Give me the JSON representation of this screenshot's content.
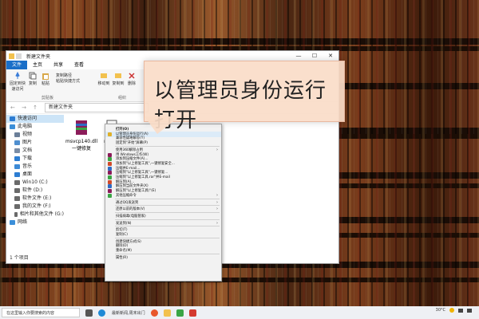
{
  "window": {
    "title": "新建文件夹",
    "tabs": [
      "文件",
      "主页",
      "共享",
      "查看"
    ],
    "ribbon": {
      "pin_label": "固定到快速访问",
      "copy_label": "复制",
      "paste_label": "粘贴",
      "copy_path_label": "复制路径",
      "paste_shortcut_label": "粘贴快捷方式",
      "clipboard_group": "剪贴板",
      "move_label": "移动到",
      "copy_to_label": "复制到",
      "delete_label": "删除",
      "organize_group": "组织"
    },
    "address_path": "新建文件夹",
    "nav_items": [
      {
        "label": "快速访问",
        "icon": "star-icon",
        "color": "#2d7dd2"
      },
      {
        "label": "此电脑",
        "icon": "computer-icon",
        "color": "#3b8fd9"
      },
      {
        "label": "视频",
        "icon": "video-icon",
        "color": "#6b7f99"
      },
      {
        "label": "图片",
        "icon": "picture-icon",
        "color": "#4f8fcf"
      },
      {
        "label": "文档",
        "icon": "document-icon",
        "color": "#7b8da6"
      },
      {
        "label": "下载",
        "icon": "download-icon",
        "color": "#2d7dd2"
      },
      {
        "label": "音乐",
        "icon": "music-icon",
        "color": "#3d8ad6"
      },
      {
        "label": "桌面",
        "icon": "desktop-icon",
        "color": "#2d7dd2"
      },
      {
        "label": "Win10 (C:)",
        "icon": "drive-icon",
        "color": "#6a6a6a"
      },
      {
        "label": "软件 (D:)",
        "icon": "drive-icon",
        "color": "#6a6a6a"
      },
      {
        "label": "软件文件 (E:)",
        "icon": "drive-icon",
        "color": "#6a6a6a"
      },
      {
        "label": "我的文件 (F:)",
        "icon": "drive-icon",
        "color": "#6a6a6a"
      },
      {
        "label": "相片和其他文件 (G:)",
        "icon": "drive-icon",
        "color": "#6a6a6a"
      },
      {
        "label": "网络",
        "icon": "network-icon",
        "color": "#3b8fd9"
      }
    ],
    "files": [
      {
        "name": "msvcp140.dll",
        "sub": "一键修复"
      },
      {
        "name": "msvcp",
        "sub": "一键"
      }
    ],
    "status": "1 个项目"
  },
  "callout": {
    "text": "以管理员身份运行打开"
  },
  "context_menu": {
    "items": [
      "打开(O)",
      "以管理员身份运行(A)",
      "兼容性疑难解答(Y)",
      "固定到\"开始\"屏幕(P)",
      "",
      "使用360解除占用",
      "用 Windows工作(W)",
      "添加到压缩文件(A)...",
      "添加到\"以上修复工具\",一键修复安全...",
      "压缩并E-mail...",
      "压缩到\"以上修复工具\",一键修复...",
      "压缩到\"以上修复工具.rar\"并E-mail",
      "解压到(A)...",
      "解压到当前文件夹(X)",
      "解压到\"以上修复工具\\\"(E)",
      "其他压缩命令",
      "",
      "通过QQ发送到",
      "",
      "还原以前的版本(V)",
      "",
      "扫描病毒(电脑管家)",
      "",
      "发送到(N)",
      "",
      "剪切(T)",
      "复制(C)",
      "",
      "创建快捷方式(S)",
      "删除(D)",
      "重命名(M)",
      "",
      "属性(R)"
    ],
    "submenu_rows": [
      5,
      15,
      17,
      19,
      23
    ]
  },
  "taskbar": {
    "search_placeholder": "在这里输入你要搜索的内容",
    "weather": "最新新闻,周末出门",
    "temperature": "30°C",
    "clock_time": "",
    "clock_date": ""
  }
}
